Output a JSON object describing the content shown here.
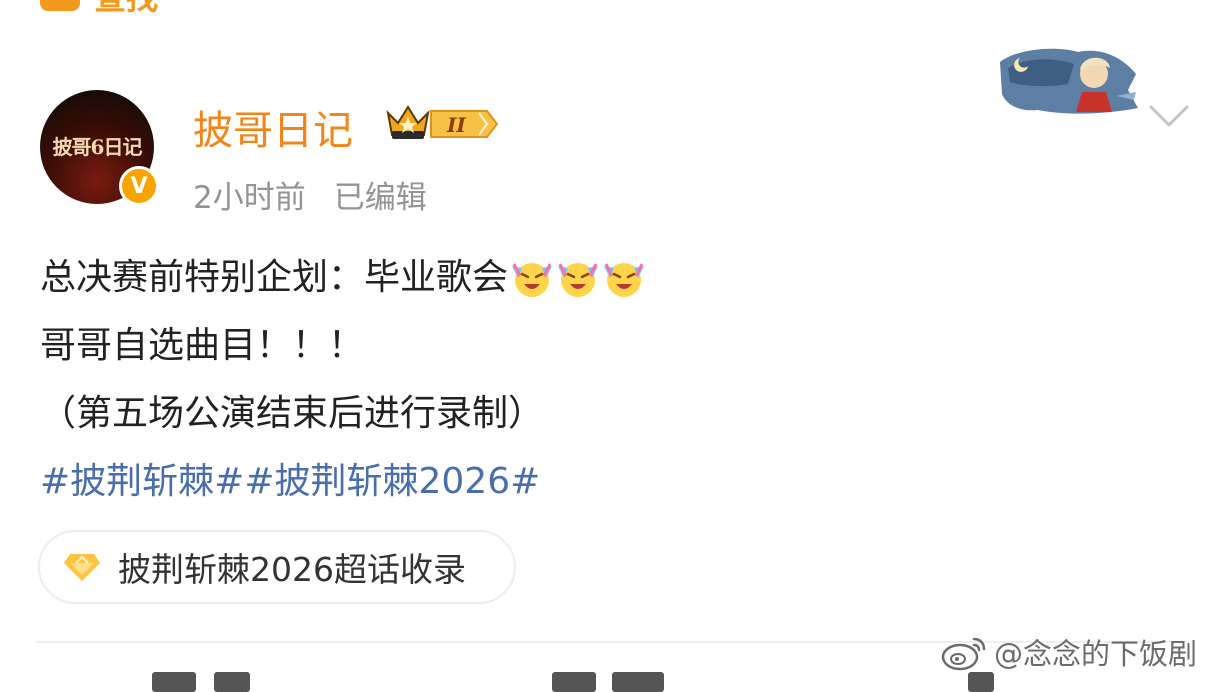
{
  "top_partial": {
    "label": "查找"
  },
  "post": {
    "author": {
      "name": "披哥日记",
      "avatar_text": "披哥6日记",
      "verified_mark": "V",
      "level_badge": "II"
    },
    "time": "2小时前",
    "edited": "已编辑",
    "lines": [
      "总决赛前特别企划：毕业歌会",
      "哥哥自选曲目！！！",
      "（第五场公演结束后进行录制）"
    ],
    "emoji_after_line1": [
      "laughing-tears-emoji",
      "laughing-tears-emoji",
      "laughing-tears-emoji"
    ],
    "hashtags": "#披荆斩棘##披荆斩棘2026#",
    "topic": {
      "label": "披荆斩棘2026超话收录",
      "icon": "diamond-icon"
    }
  },
  "watermark": {
    "text": "@念念的下饭剧",
    "icon": "weibo-icon"
  },
  "colors": {
    "username": "#f28518",
    "meta": "#939393",
    "hashtag": "#4a6ea9",
    "verified": "#f7a400"
  }
}
